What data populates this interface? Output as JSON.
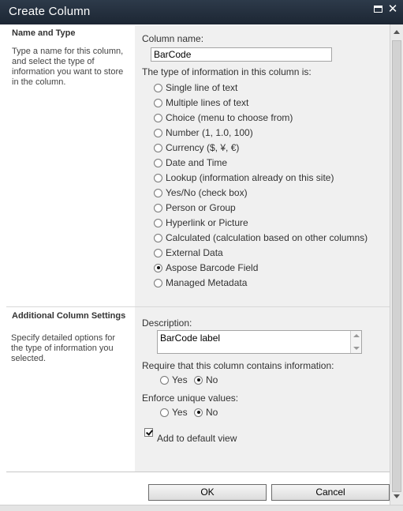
{
  "window": {
    "title": "Create Column"
  },
  "name_type": {
    "heading": "Name and Type",
    "description": "Type a name for this column, and select the type of information you want to store in the column.",
    "column_name_label": "Column name:",
    "column_name_value": "BarCode",
    "type_label": "The type of information in this column is:",
    "types": [
      {
        "label": "Single line of text",
        "selected": false
      },
      {
        "label": "Multiple lines of text",
        "selected": false
      },
      {
        "label": "Choice (menu to choose from)",
        "selected": false
      },
      {
        "label": "Number (1, 1.0, 100)",
        "selected": false
      },
      {
        "label": "Currency ($, ¥, €)",
        "selected": false
      },
      {
        "label": "Date and Time",
        "selected": false
      },
      {
        "label": "Lookup (information already on this site)",
        "selected": false
      },
      {
        "label": "Yes/No (check box)",
        "selected": false
      },
      {
        "label": "Person or Group",
        "selected": false
      },
      {
        "label": "Hyperlink or Picture",
        "selected": false
      },
      {
        "label": "Calculated (calculation based on other columns)",
        "selected": false
      },
      {
        "label": "External Data",
        "selected": false
      },
      {
        "label": "Aspose Barcode Field",
        "selected": true
      },
      {
        "label": "Managed Metadata",
        "selected": false
      }
    ]
  },
  "additional": {
    "heading": "Additional Column Settings",
    "description": "Specify detailed options for the type of information you selected.",
    "description_label": "Description:",
    "description_value": "BarCode label",
    "require_label": "Require that this column contains information:",
    "require_yes": "Yes",
    "require_no": "No",
    "unique_label": "Enforce unique values:",
    "unique_yes": "Yes",
    "unique_no": "No",
    "default_view_label": "Add to default view"
  },
  "buttons": {
    "ok": "OK",
    "cancel": "Cancel"
  }
}
